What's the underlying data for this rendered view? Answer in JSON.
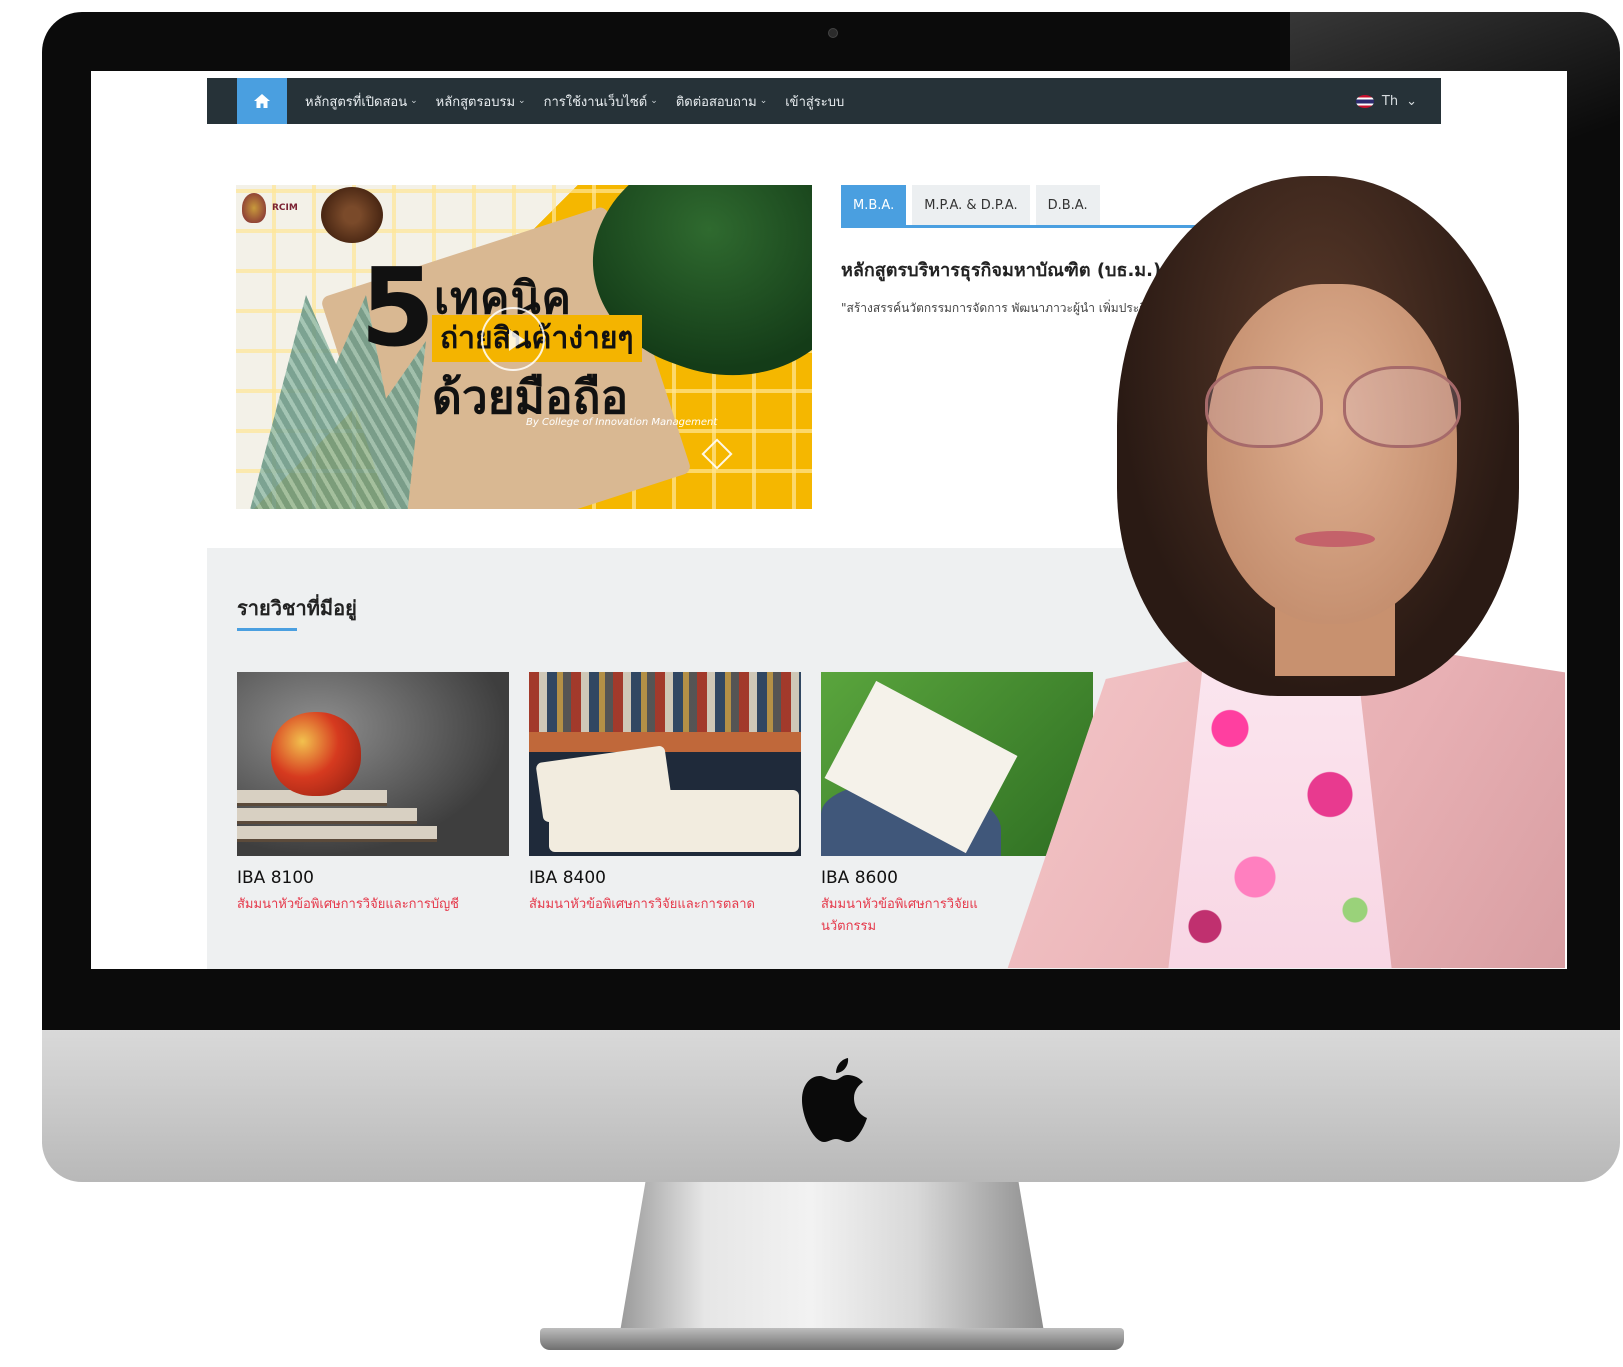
{
  "nav": {
    "home_icon": "home-icon",
    "items": [
      {
        "label": "หลักสูตรที่เปิดสอน",
        "chevron": "⌄"
      },
      {
        "label": "หลักสูตรอบรม",
        "chevron": "⌄"
      },
      {
        "label": "การใช้งานเว็บไซต์",
        "chevron": "⌄"
      },
      {
        "label": "ติดต่อสอบถาม",
        "chevron": "⌄"
      },
      {
        "label": "เข้าสู่ระบบ",
        "chevron": ""
      }
    ],
    "language": {
      "label": "Th",
      "chevron": "⌄",
      "flag": "thai-flag"
    }
  },
  "hero": {
    "number": "5",
    "line1": "เทคนิค",
    "line2": "ถ่ายสินค้าง่ายๆ",
    "line3": "ด้วยมือถือ",
    "byline": "By College of Innovation Management",
    "logo_text": "RCIM",
    "play_icon": "play-icon"
  },
  "program_tabs": {
    "tabs": [
      "M.B.A.",
      "M.P.A. & D.P.A.",
      "D.B.A."
    ],
    "active_index": 0,
    "title": "หลักสูตรบริหารธุรกิจมหาบัณฑิต (บธ.ม.)",
    "description": "\"สร้างสรรค์นวัตกรรมการจัดการ พัฒนาภาวะผู้นำ เพิ่มประสิ"
  },
  "courses": {
    "heading": "รายวิชาที่มีอยู่",
    "items": [
      {
        "code": "IBA 8100",
        "name": "สัมมนาหัวข้อพิเศษการวิจัยและการบัญชี"
      },
      {
        "code": "IBA 8400",
        "name": "สัมมนาหัวข้อพิเศษการวิจัยและการตลาด"
      },
      {
        "code": "IBA 8600",
        "name": "สัมมนาหัวข้อพิเศษการวิจัยแ\nนวัตกรรม"
      }
    ]
  },
  "colors": {
    "nav_bg": "#263238",
    "accent": "#4a9fe0",
    "course_link": "#e5394b",
    "section_bg": "#eef0f1"
  }
}
